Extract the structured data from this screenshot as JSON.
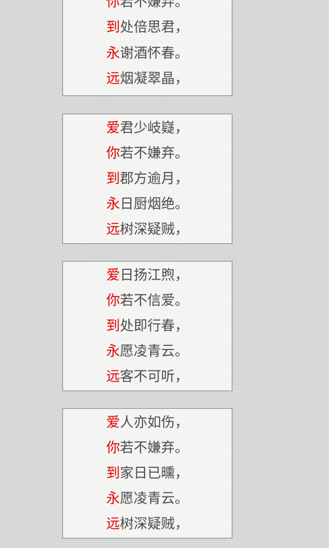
{
  "poems": [
    {
      "lines": [
        {
          "first": "你",
          "rest": "若不嫌弃。"
        },
        {
          "first": "到",
          "rest": "处倍思君，"
        },
        {
          "first": "永",
          "rest": "谢酒怀春。"
        },
        {
          "first": "远",
          "rest": "烟凝翠晶，"
        }
      ]
    },
    {
      "lines": [
        {
          "first": "爱",
          "rest": "君少岐嶷，"
        },
        {
          "first": "你",
          "rest": "若不嫌弃。"
        },
        {
          "first": "到",
          "rest": "郡方逾月，"
        },
        {
          "first": "永",
          "rest": "日厨烟绝。"
        },
        {
          "first": "远",
          "rest": "树深疑贼，"
        }
      ]
    },
    {
      "lines": [
        {
          "first": "爱",
          "rest": "日扬江煦，"
        },
        {
          "first": "你",
          "rest": "若不信爱。"
        },
        {
          "first": "到",
          "rest": "处即行春，"
        },
        {
          "first": "永",
          "rest": "愿凌青云。"
        },
        {
          "first": "远",
          "rest": "客不可听，"
        }
      ]
    },
    {
      "lines": [
        {
          "first": "爱",
          "rest": "人亦如伤，"
        },
        {
          "first": "你",
          "rest": "若不嫌弃。"
        },
        {
          "first": "到",
          "rest": "家日已曛，"
        },
        {
          "first": "永",
          "rest": "愿凌青云。"
        },
        {
          "first": "远",
          "rest": "树深疑贼，"
        }
      ]
    }
  ]
}
